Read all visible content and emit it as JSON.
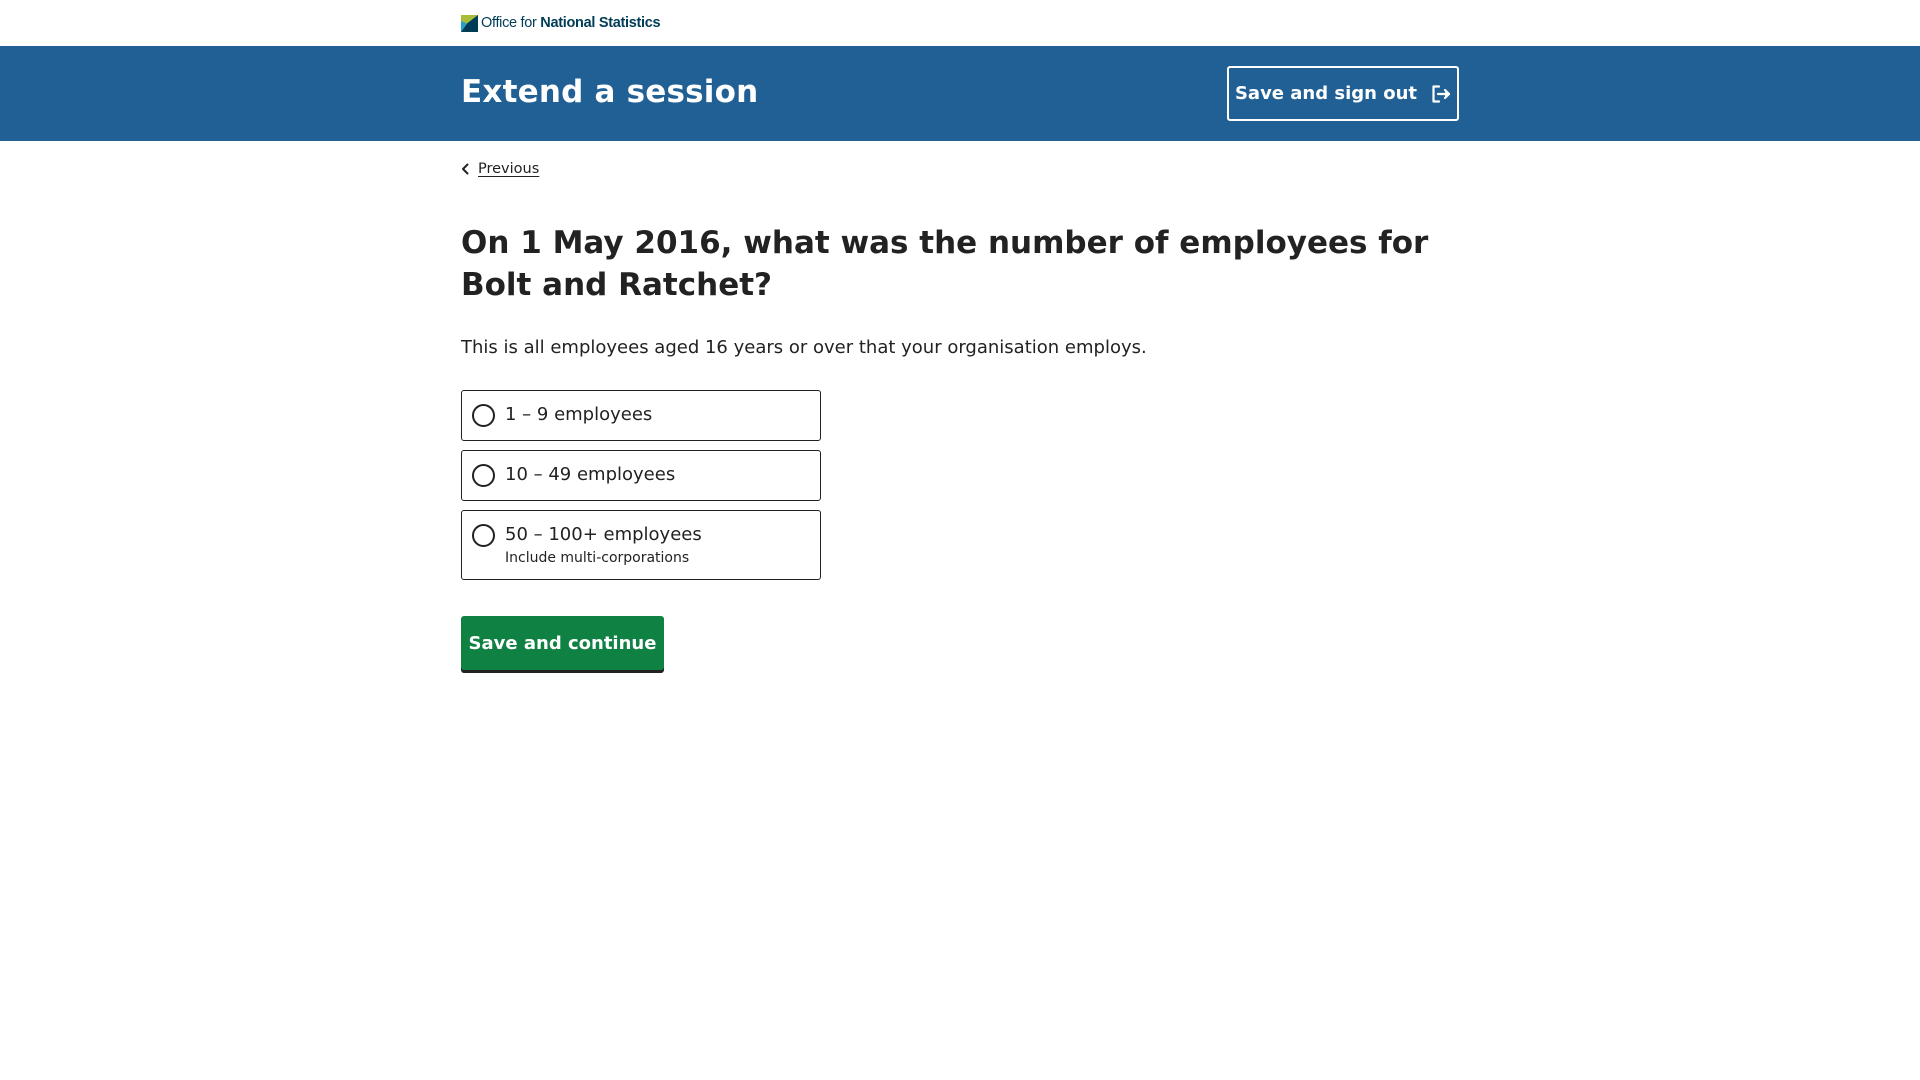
{
  "header": {
    "logo": {
      "icon": "ons-logo-icon",
      "text_regular": "Office for ",
      "text_bold": "National Statistics",
      "colors": {
        "dark": "#003c57",
        "green": "#a8bd3a"
      }
    }
  },
  "banner": {
    "title": "Extend a session",
    "background": "#206095",
    "sign_out_label": "Save and sign out",
    "sign_out_icon": "exit-icon"
  },
  "nav": {
    "previous_label": "Previous",
    "previous_icon": "chevron-left-icon"
  },
  "question": {
    "title": "On 1 May 2016, what was the number of employees for Bolt and Ratchet?",
    "description": "This is all employees aged 16 years or over that your organisation employs.",
    "options": [
      {
        "label": "1 – 9 employees",
        "hint": "",
        "selected": false
      },
      {
        "label": "10 – 49 employees",
        "hint": "",
        "selected": false
      },
      {
        "label": "50 – 100+ employees",
        "hint": "Include multi-corporations",
        "selected": false
      }
    ]
  },
  "actions": {
    "continue_label": "Save and continue",
    "continue_color": "#0f8243"
  }
}
